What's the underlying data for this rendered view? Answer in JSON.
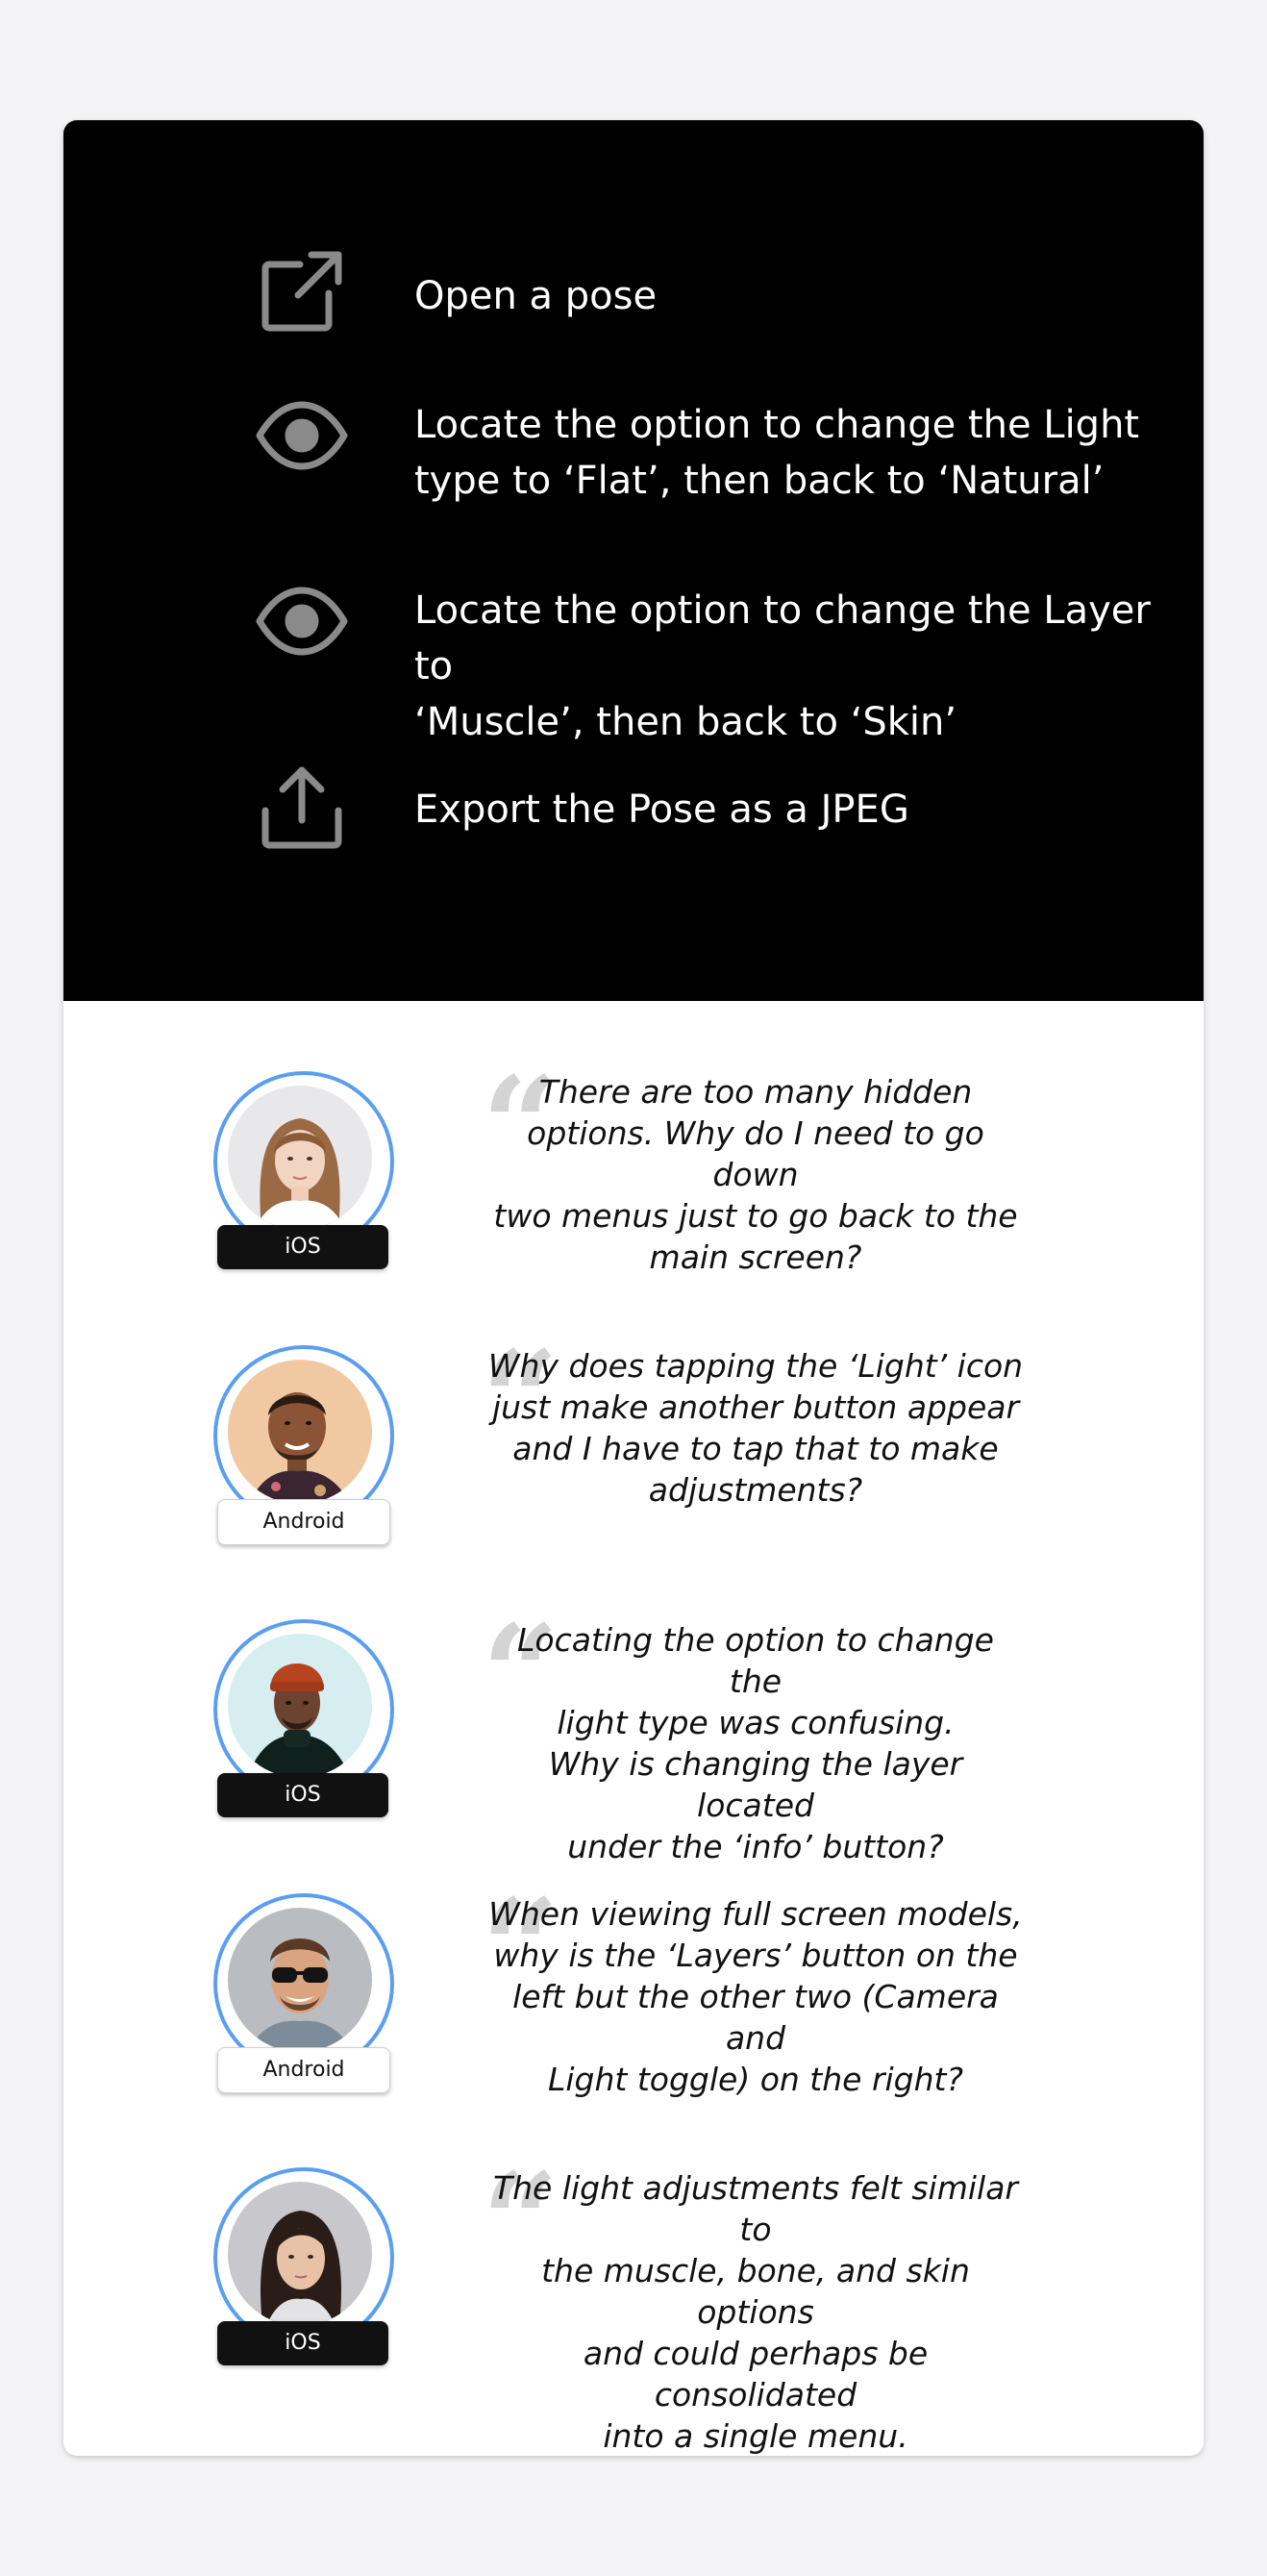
{
  "tasks": [
    {
      "icon": "external-link-icon",
      "text": "Open a pose"
    },
    {
      "icon": "eye-icon",
      "text": "Locate the option to change the Light\ntype to ‘Flat’, then back to ‘Natural’"
    },
    {
      "icon": "eye-icon",
      "text": "Locate the option to change the Layer to\n‘Muscle’, then back to ‘Skin’"
    },
    {
      "icon": "upload-icon",
      "text": "Export the Pose as a JPEG"
    }
  ],
  "quotes": [
    {
      "platform": "iOS",
      "text": "There are too many hidden\noptions. Why do I need to go down\ntwo menus just to go back to the\nmain screen?"
    },
    {
      "platform": "Android",
      "text": "Why does tapping the ‘Light’ icon\njust make another button appear\nand I have to tap that to make\nadjustments?"
    },
    {
      "platform": "iOS",
      "text": "Locating the option to change the\nlight type was confusing.\nWhy is changing the layer located\nunder the ‘info’ button?"
    },
    {
      "platform": "Android",
      "text": "When viewing full screen models,\nwhy is the ‘Layers’ button on the\nleft but the other two (Camera and\nLight toggle) on the right?"
    },
    {
      "platform": "iOS",
      "text": "The light adjustments felt similar to\nthe muscle, bone, and skin options\nand could perhaps be consolidated\ninto a single menu."
    }
  ],
  "colors": {
    "page_background": "#f3f3f5",
    "task_panel": "#000000",
    "avatar_ring": "#5b9ef0",
    "icon_gray": "#8a8a8a",
    "quote_mark": "#d4d4d4"
  }
}
